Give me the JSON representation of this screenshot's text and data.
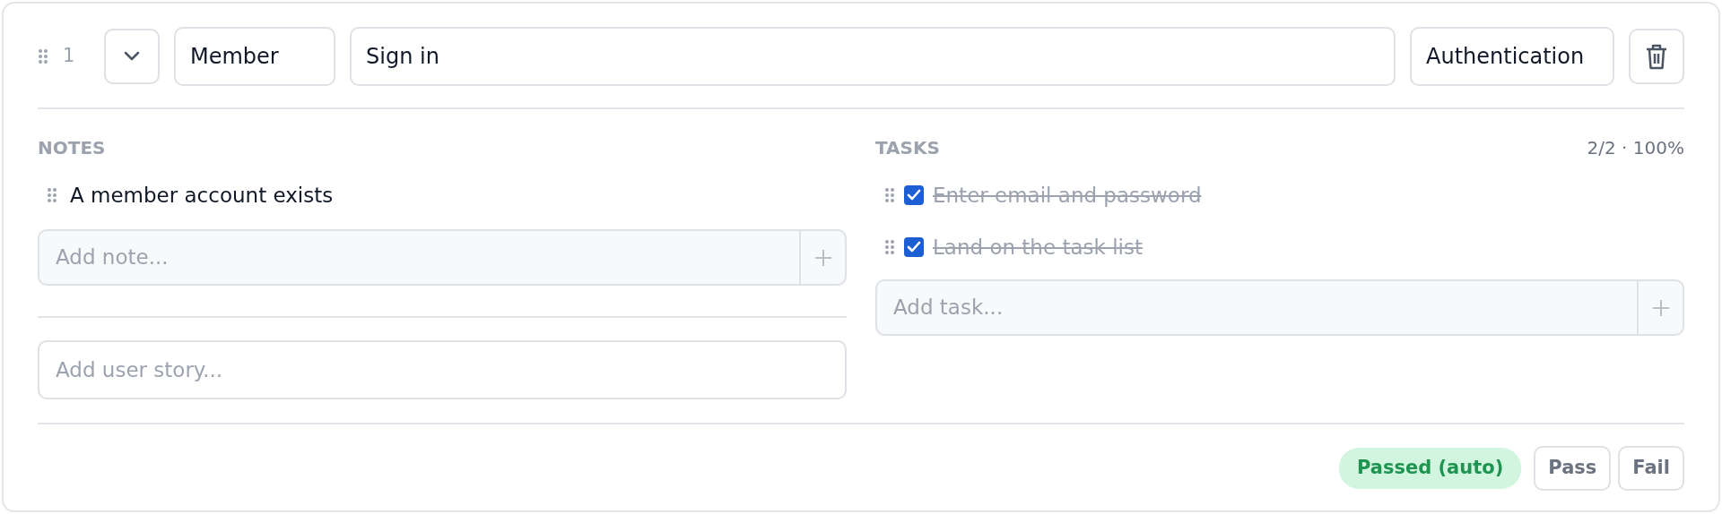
{
  "header": {
    "number": "1",
    "expanded": true,
    "role": "Member",
    "title": "Sign in",
    "category": "Authentication"
  },
  "notes": {
    "heading": "NOTES",
    "items": [
      {
        "text": "A member account exists"
      }
    ],
    "add_placeholder": "Add note...",
    "story_placeholder": "Add user story..."
  },
  "tasks": {
    "heading": "TASKS",
    "progress": "2/2 · 100%",
    "items": [
      {
        "text": "Enter email and password",
        "checked": true
      },
      {
        "text": "Land on the task list",
        "checked": true
      }
    ],
    "add_placeholder": "Add task..."
  },
  "footer": {
    "status": {
      "label": "Passed (auto)",
      "kind": "passed"
    },
    "buttons": [
      "Pass",
      "Fail"
    ]
  }
}
